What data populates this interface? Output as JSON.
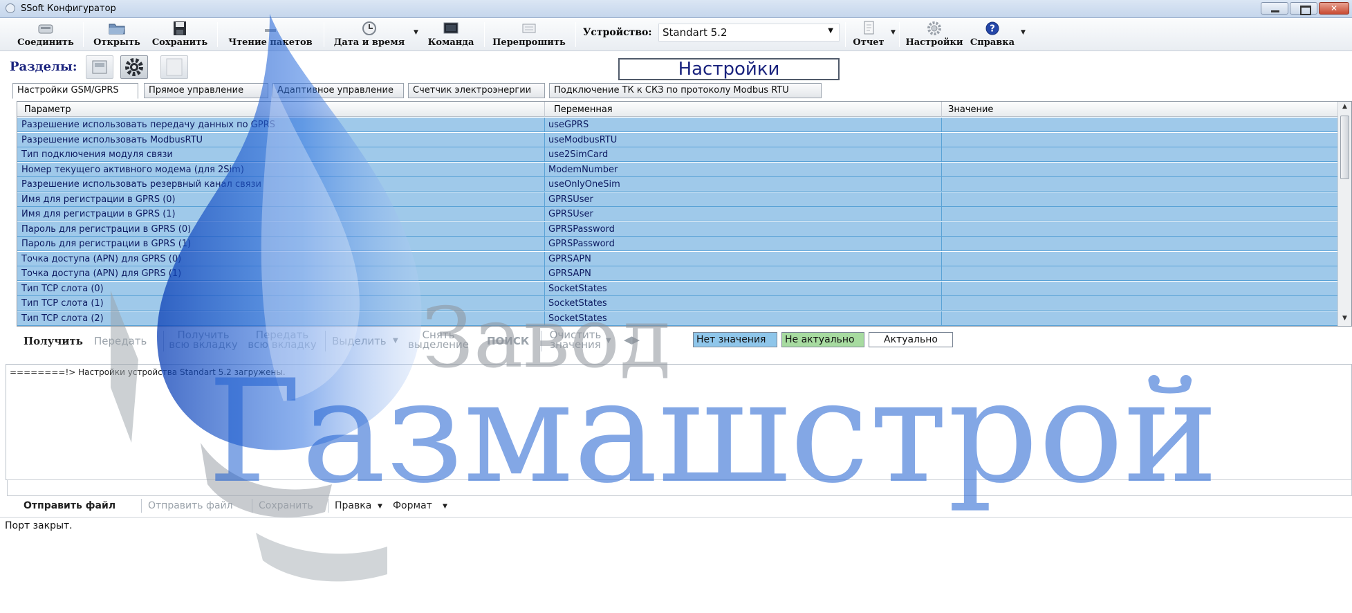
{
  "window": {
    "title": "SSoft Конфигуратор"
  },
  "toolbar": {
    "connect": "Соединить",
    "open": "Открыть",
    "save": "Сохранить",
    "read_packets": "Чтение пакетов",
    "datetime": "Дата и время",
    "command": "Команда",
    "reflash": "Перепрошить",
    "device_label": "Устройство:",
    "device_value": "Standart 5.2",
    "report": "Отчет",
    "settings": "Настройки",
    "help": "Справка"
  },
  "sections": {
    "label": "Разделы:"
  },
  "page_title": "Настройки",
  "tabs": [
    {
      "label": "Настройки GSM/GPRS"
    },
    {
      "label": "Прямое управление"
    },
    {
      "label": "Адаптивное управление"
    },
    {
      "label": "Счетчик электроэнергии"
    },
    {
      "label": "Подключение ТК к СКЗ по протоколу Modbus RTU"
    }
  ],
  "grid": {
    "headers": [
      "Параметр",
      "Переменная",
      "Значение"
    ],
    "rows": [
      {
        "param": "Разрешение использовать передачу данных по GPRS",
        "var": "useGPRS"
      },
      {
        "param": "Разрешение использовать ModbusRTU",
        "var": "useModbusRTU"
      },
      {
        "param": "Тип подключения модуля связи",
        "var": "use2SimCard"
      },
      {
        "param": "Номер текущего активного модема (для 2Sim)",
        "var": "ModemNumber"
      },
      {
        "param": "Разрешение использовать резервный канал связи",
        "var": "useOnlyOneSim"
      },
      {
        "param": "Имя для регистрации в GPRS (0)",
        "var": "GPRSUser"
      },
      {
        "param": "Имя для регистрации в GPRS (1)",
        "var": "GPRSUser"
      },
      {
        "param": "Пароль для регистрации в GPRS (0)",
        "var": "GPRSPassword"
      },
      {
        "param": "Пароль для регистрации в GPRS (1)",
        "var": "GPRSPassword"
      },
      {
        "param": "Точка доступа (APN) для GPRS (0)",
        "var": "GPRSAPN"
      },
      {
        "param": "Точка доступа (APN) для GPRS (1)",
        "var": "GPRSAPN"
      },
      {
        "param": "Тип TCP слота (0)",
        "var": "SocketStates"
      },
      {
        "param": "Тип TCP слота (1)",
        "var": "SocketStates"
      },
      {
        "param": "Тип TCP слота (2)",
        "var": "SocketStates"
      }
    ]
  },
  "actions": {
    "get": "Получить",
    "send": "Передать",
    "get_all_1": "Получить",
    "get_all_2": "всю вкладку",
    "send_all_1": "Передать",
    "send_all_2": "всю вкладку",
    "select": "Выделить",
    "deselect_1": "Снять",
    "deselect_2": "выделение",
    "search": "ПОИСК",
    "clear_1": "Очистить",
    "clear_2": "значения"
  },
  "legend": {
    "no_value": "Нет значения",
    "not_actual": "Не актуально",
    "actual": "Актуально"
  },
  "log": {
    "line": "========!> Настройки устройства Standart 5.2 загружены."
  },
  "log_toolbar": {
    "send_file": "Отправить файл",
    "send_file_dim": "Отправить файл",
    "save": "Сохранить",
    "edit": "Правка",
    "format": "Формат"
  },
  "status": {
    "text": "Порт закрыт."
  },
  "watermark": {
    "line1": "Завод",
    "line2": "Газмашстрой"
  },
  "colors": {
    "row_bg": "#9fc9ea",
    "legend_no_value": "#8fc6ea",
    "legend_not_actual": "#a7dba0",
    "watermark_blue": "#1e5fd0"
  }
}
